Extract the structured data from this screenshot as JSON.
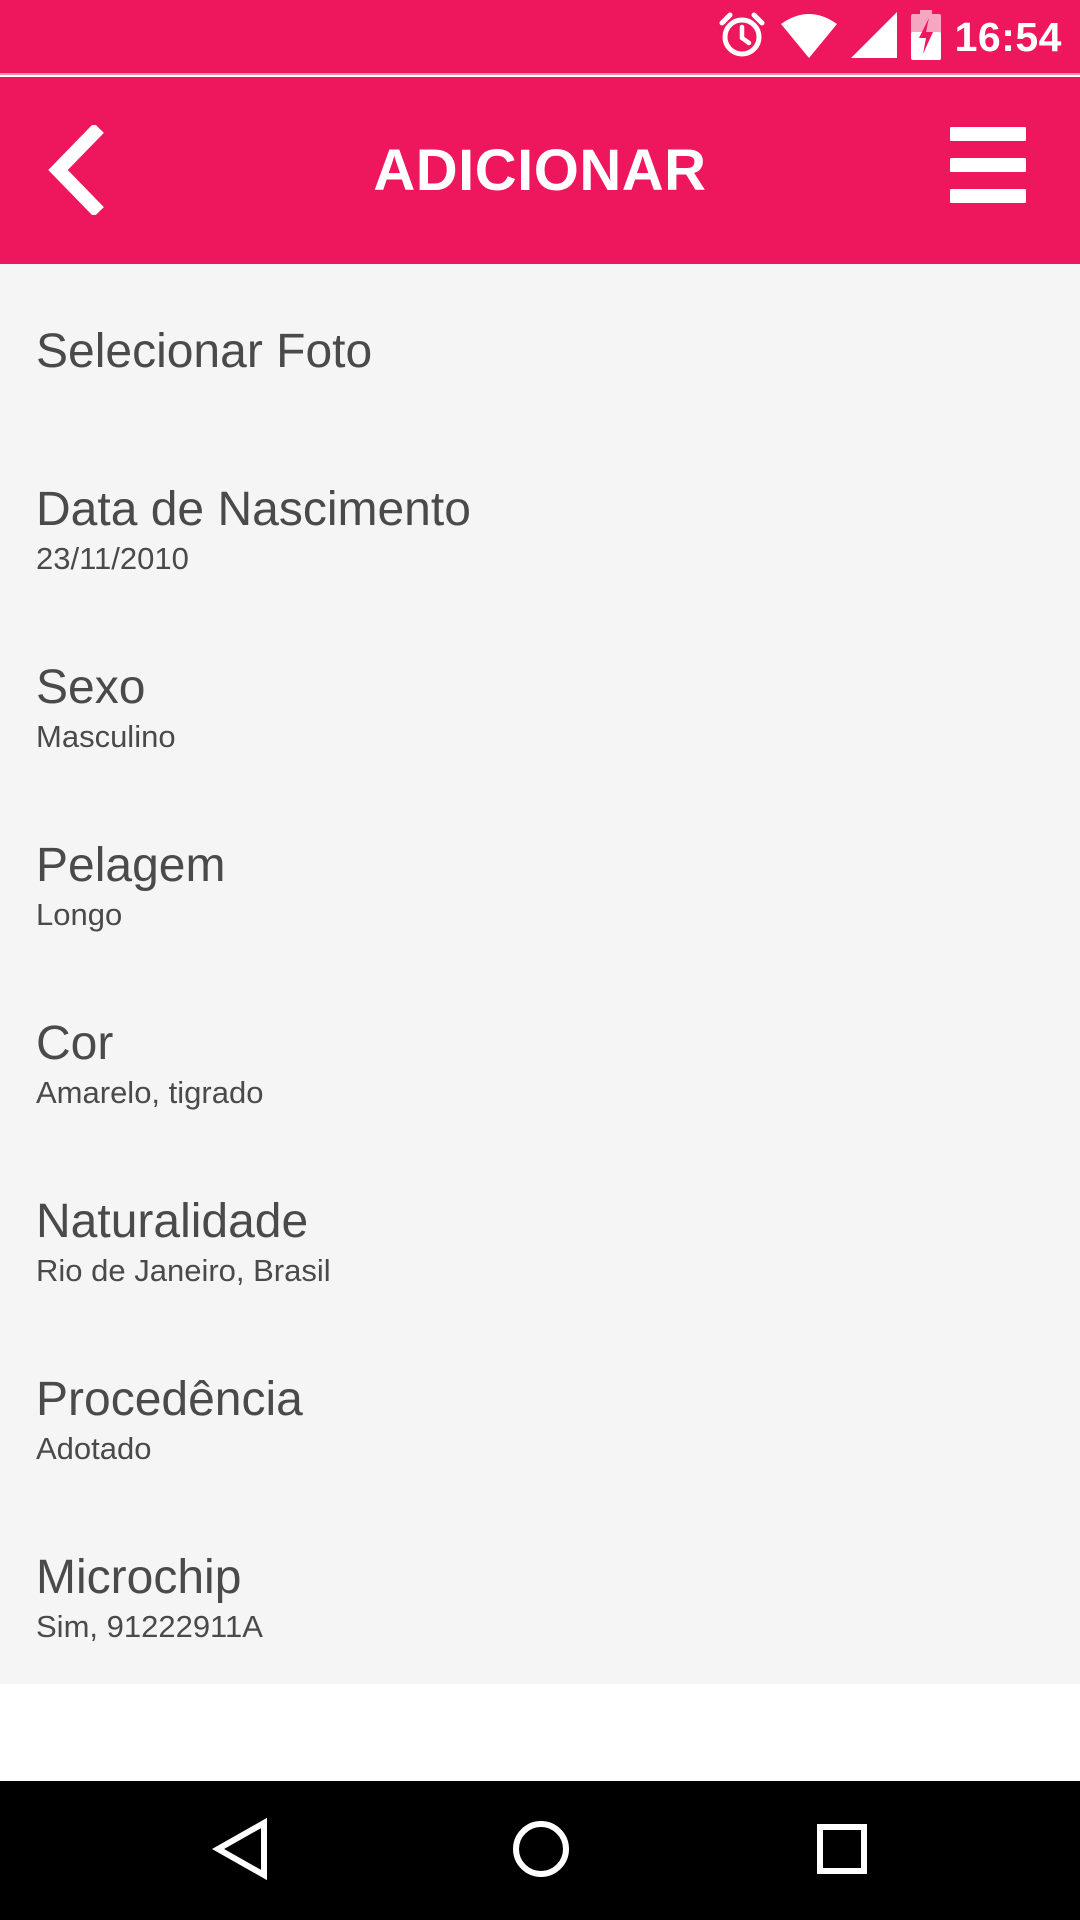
{
  "status_bar": {
    "time": "16:54",
    "icons": [
      "alarm-icon",
      "wifi-icon",
      "signal-icon",
      "battery-charging-icon"
    ]
  },
  "toolbar": {
    "title": "ADICIONAR",
    "back_icon": "chevron-left-icon",
    "menu_icon": "hamburger-menu-icon"
  },
  "form": {
    "select_photo": "Selecionar Foto",
    "fields": [
      {
        "label": "Data de Nascimento",
        "value": "23/11/2010"
      },
      {
        "label": "Sexo",
        "value": "Masculino"
      },
      {
        "label": "Pelagem",
        "value": "Longo"
      },
      {
        "label": "Cor",
        "value": "Amarelo, tigrado"
      },
      {
        "label": "Naturalidade",
        "value": "Rio de Janeiro, Brasil"
      },
      {
        "label": "Procedência",
        "value": "Adotado"
      },
      {
        "label": "Microchip",
        "value": "Sim, 91222911A"
      }
    ]
  },
  "nav_bar": {
    "icons": [
      "back-triangle-icon",
      "home-circle-icon",
      "recents-square-icon"
    ]
  },
  "colors": {
    "accent": "#ee175d",
    "content_background": "#f5f5f5",
    "text": "#4a4a4a"
  }
}
